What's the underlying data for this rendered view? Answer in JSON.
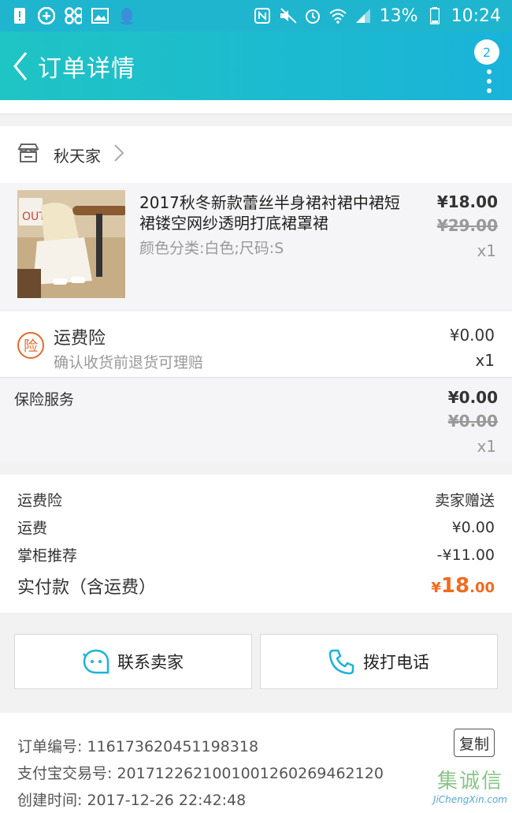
{
  "statusbar": {
    "battery": "13%",
    "time": "10:24"
  },
  "header": {
    "title": "订单详情",
    "badge": "2"
  },
  "shop": {
    "name": "秋天家"
  },
  "item": {
    "title": "2017秋冬新款蕾丝半身裙衬裙中裙短裙镂空网纱透明打底裙罩裙",
    "spec": "颜色分类:白色;尺码:S",
    "price": "¥18.00",
    "original_price": "¥29.00",
    "qty": "x1"
  },
  "insurance": {
    "icon_text": "险",
    "title": "运费险",
    "desc": "确认收货前退货可理赔",
    "price": "¥0.00",
    "qty": "x1"
  },
  "service": {
    "title": "保险服务",
    "price": "¥0.00",
    "original_price": "¥0.00",
    "qty": "x1"
  },
  "summary": {
    "rows": [
      {
        "label": "运费险",
        "value": "卖家赠送"
      },
      {
        "label": "运费",
        "value": "¥0.00"
      },
      {
        "label": "掌柜推荐",
        "value": "-¥11.00"
      }
    ],
    "total_label": "实付款（含运费）",
    "total_symbol": "¥",
    "total_int": "18",
    "total_dec": ".00"
  },
  "actions": {
    "contact": "联系卖家",
    "call": "拨打电话"
  },
  "order": {
    "number": "订单编号: 116173620451198318",
    "alipay": "支付宝交易号: 2017122621001001260269462120",
    "created": "创建时间: 2017-12-26 22:42:48",
    "copy": "复制"
  },
  "watermark": {
    "line1": "集诚信",
    "line2": "JiChengXin.com"
  },
  "colors": {
    "header_start": "#1fc4c4",
    "header_end": "#1ab3d9",
    "accent": "#f26b1d",
    "insurance": "#e4692d"
  }
}
